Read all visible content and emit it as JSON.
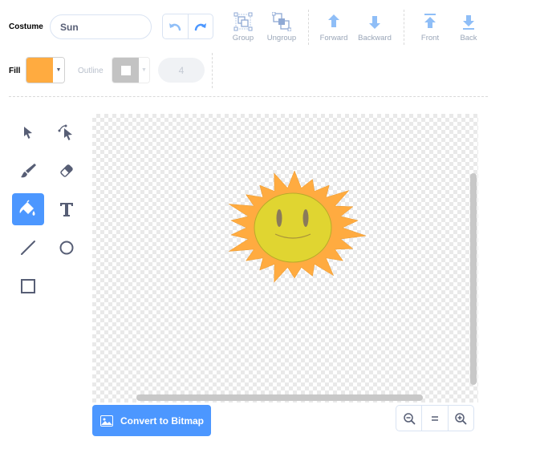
{
  "costume": {
    "label": "Costume",
    "name_value": "Sun"
  },
  "toolbar": {
    "group": "Group",
    "ungroup": "Ungroup",
    "forward": "Forward",
    "backward": "Backward",
    "front": "Front",
    "back": "Back"
  },
  "fill": {
    "label": "Fill",
    "color": "#ffab40"
  },
  "outline": {
    "label": "Outline",
    "color": "#ffffff",
    "width_value": "4"
  },
  "tools": [
    "select-tool",
    "reshape-tool",
    "brush-tool",
    "eraser-tool",
    "fill-tool",
    "text-tool",
    "line-tool",
    "circle-tool",
    "rectangle-tool"
  ],
  "selected_tool": "fill-tool",
  "accent_color": "#4c97ff",
  "convert_button": {
    "label": "Convert to Bitmap"
  },
  "zoom": {
    "zoom_out": "zoom-out-icon",
    "reset": "zoom-reset-icon",
    "zoom_in": "zoom-in-icon"
  }
}
